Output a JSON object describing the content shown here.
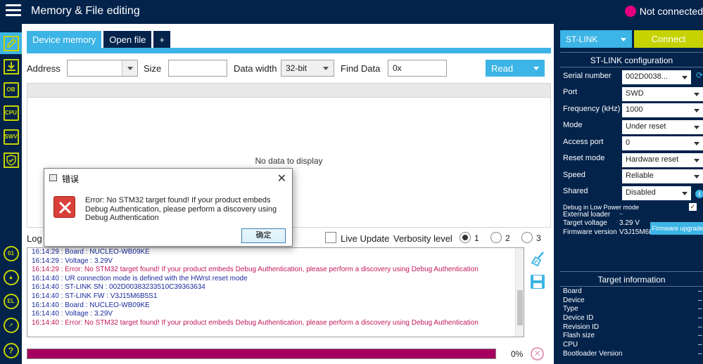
{
  "header": {
    "title": "Memory & File editing",
    "status": "Not connected",
    "status_color": "#e6007e"
  },
  "sidebar": {
    "items": [
      {
        "name": "memory-edit",
        "label": ""
      },
      {
        "name": "erase-program",
        "label": ""
      },
      {
        "name": "option-bytes",
        "label": "OB"
      },
      {
        "name": "cpu",
        "label": "CPU"
      },
      {
        "name": "swv",
        "label": "SWV"
      },
      {
        "name": "security",
        "label": ""
      },
      {
        "name": "bottom-1",
        "label": "01"
      },
      {
        "name": "bottom-2",
        "label": ""
      },
      {
        "name": "bottom-3",
        "label": "EL"
      },
      {
        "name": "bottom-4",
        "label": ""
      },
      {
        "name": "help",
        "label": "?"
      }
    ]
  },
  "tabs": [
    {
      "label": "Device memory"
    },
    {
      "label": "Open file"
    },
    {
      "label": "+"
    }
  ],
  "toolbar": {
    "address_label": "Address",
    "address_value": "",
    "size_label": "Size",
    "size_value": "",
    "data_width_label": "Data width",
    "data_width_value": "32-bit",
    "find_label": "Find Data",
    "find_value": "0x",
    "read_label": "Read"
  },
  "data_area": {
    "empty_text": "No data to display"
  },
  "log": {
    "label": "Log",
    "live_update_label": "Live Update",
    "verbosity_label": "Verbosity level",
    "levels": [
      "1",
      "2",
      "3"
    ],
    "selected_level": "1",
    "lines": [
      {
        "text": "16:14:29 : Board       : NUCLEO-WB09KE",
        "kind": "info"
      },
      {
        "text": "16:14:29 : Voltage     : 3.29V",
        "kind": "info"
      },
      {
        "text": "16:14:29 : Error: No STM32 target found! If your product embeds Debug Authentication, please perform a discovery using Debug Authentication",
        "kind": "error"
      },
      {
        "text": "16:14:40 : UR connection mode is defined with the HWrst reset mode",
        "kind": "info"
      },
      {
        "text": "16:14:40 : ST-LINK SN  : 002D00383233510C39363634",
        "kind": "info"
      },
      {
        "text": "16:14:40 : ST-LINK FW  : V3J15M6B5S1",
        "kind": "info"
      },
      {
        "text": "16:14:40 : Board       : NUCLEO-WB09KE",
        "kind": "info"
      },
      {
        "text": "16:14:40 : Voltage     : 3.29V",
        "kind": "info"
      },
      {
        "text": "16:14:40 : Error: No STM32 target found! If your product embeds Debug Authentication, please perform a discovery using Debug Authentication",
        "kind": "error"
      }
    ]
  },
  "progress": {
    "percent_text": "0%",
    "bar_color": "#a6005e"
  },
  "connection": {
    "probe": "ST-LINK",
    "connect_label": "Connect",
    "config_title": "ST-LINK configuration",
    "rows": [
      {
        "label": "Serial number",
        "value": "002D0038..."
      },
      {
        "label": "Port",
        "value": "SWD"
      },
      {
        "label": "Frequency (kHz)",
        "value": "1000"
      },
      {
        "label": "Mode",
        "value": "Under reset"
      },
      {
        "label": "Access port",
        "value": "0"
      },
      {
        "label": "Reset mode",
        "value": "Hardware reset"
      },
      {
        "label": "Speed",
        "value": "Reliable"
      },
      {
        "label": "Shared",
        "value": "Disabled"
      }
    ],
    "low_power_label": "Debug in Low Power mode",
    "low_power_checked": "✓",
    "external_loader_label": "External loader",
    "external_loader_value": "..",
    "target_voltage_label": "Target voltage",
    "target_voltage_value": "3.29 V",
    "firmware_version_label": "Firmware version",
    "firmware_version_value": "V3J15M6B",
    "firmware_upgrade_label": "Firmware upgrade"
  },
  "target_info": {
    "title": "Target information",
    "rows": [
      {
        "label": "Board",
        "value": "–"
      },
      {
        "label": "Device",
        "value": "–"
      },
      {
        "label": "Type",
        "value": "–"
      },
      {
        "label": "Device ID",
        "value": "–"
      },
      {
        "label": "Revision ID",
        "value": "–"
      },
      {
        "label": "Flash size",
        "value": "–"
      },
      {
        "label": "CPU",
        "value": "–"
      },
      {
        "label": "Bootloader Version",
        "value": "–"
      }
    ]
  },
  "dialog": {
    "title": "错误",
    "message": "Error: No STM32 target found! If your product embeds Debug Authentication, please perform a discovery using Debug Authentication",
    "ok_label": "确定"
  },
  "colors": {
    "navy": "#03234b",
    "blue": "#3cb4e6",
    "lime": "#c6d300",
    "magenta": "#e6007e"
  }
}
